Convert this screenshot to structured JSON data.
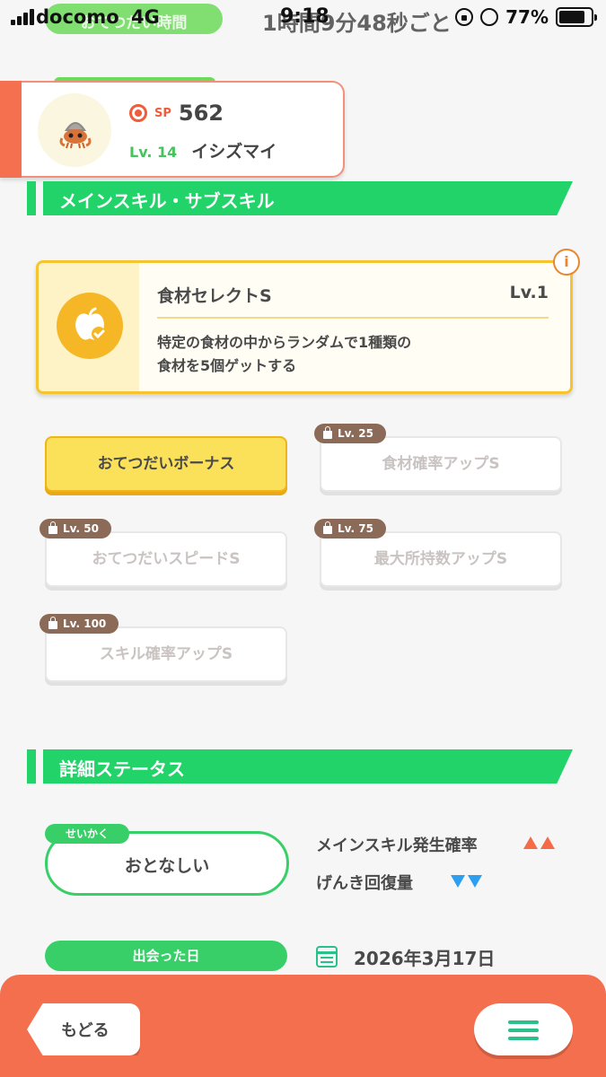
{
  "status_bar": {
    "carrier": "docomo",
    "network": "4G",
    "background_pill": "おてつだい時間",
    "timer_text": "1時間9分48秒ごと",
    "clock": "9:18",
    "battery": "77%"
  },
  "pokemon": {
    "sp_label": "SP",
    "sp_value": "562",
    "level": "Lv. 14",
    "name": "イシズマイ"
  },
  "sections": {
    "skills_title": "メインスキル・サブスキル",
    "status_title": "詳細ステータス"
  },
  "main_skill": {
    "name": "食材セレクトS",
    "level": "Lv.1",
    "description_line1": "特定の食材の中からランダムで1種類の",
    "description_line2": "食材を5個ゲットする",
    "info_label": "i"
  },
  "sub_skills": [
    {
      "label": "おてつだいボーナス",
      "lock": "",
      "active": true
    },
    {
      "label": "食材確率アップS",
      "lock": "Lv. 25",
      "active": false
    },
    {
      "label": "おてつだいスピードS",
      "lock": "Lv. 50",
      "active": false
    },
    {
      "label": "最大所持数アップS",
      "lock": "Lv. 75",
      "active": false
    },
    {
      "label": "スキル確率アップS",
      "lock": "Lv. 100",
      "active": false
    }
  ],
  "nature": {
    "tag": "せいかく",
    "value": "おとなしい",
    "up_effect": "メインスキル発生確率",
    "down_effect": "げんき回復量"
  },
  "met": {
    "label": "出会った日",
    "date": "2026年3月17日"
  },
  "bottom": {
    "back_label": "もどる"
  },
  "colors": {
    "accent_green": "#22d36a",
    "accent_orange": "#f36f4d",
    "skill_yellow": "#f6c431"
  }
}
